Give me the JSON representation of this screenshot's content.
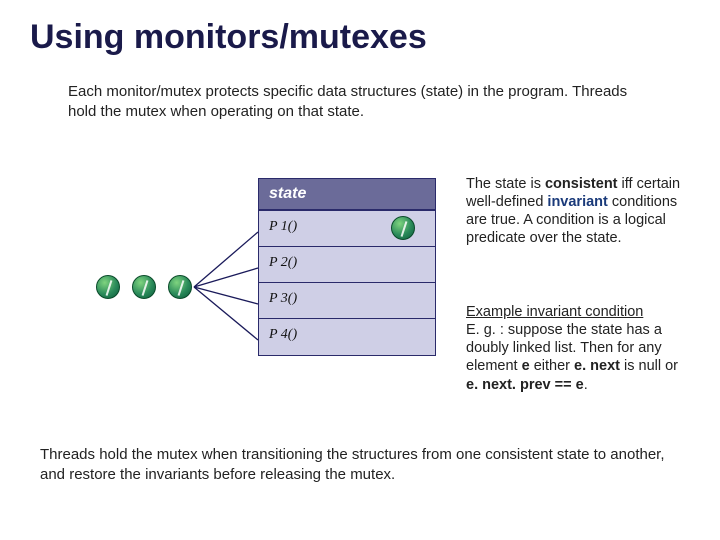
{
  "title": "Using monitors/mutexes",
  "intro": "Each monitor/mutex protects specific data structures (state) in the program.  Threads hold the mutex when operating on that state.",
  "monitor": {
    "header": "state",
    "rows": [
      "P 1()",
      "P 2()",
      "P 3()",
      "P 4()"
    ]
  },
  "right": {
    "p1_pre": "The state is ",
    "p1_strong": "consistent",
    "p1_post1": " iff certain well-defined ",
    "p1_inv": "invariant",
    "p1_post2": " conditions are true.  A condition is a logical predicate over the state.",
    "p2a": "Example invariant condition",
    "p2b": "E. g. : suppose the state has a doubly linked list.  Then for any element ",
    "p2_e1": "e",
    "p2_mid1": " either ",
    "p2_e2": "e. next",
    "p2_mid2": " is null or ",
    "p2_e3": "e. next. prev == e",
    "p2_end": "."
  },
  "footer": "Threads hold the mutex when transitioning the structures from one consistent state to another, and restore the invariants before releasing the mutex."
}
